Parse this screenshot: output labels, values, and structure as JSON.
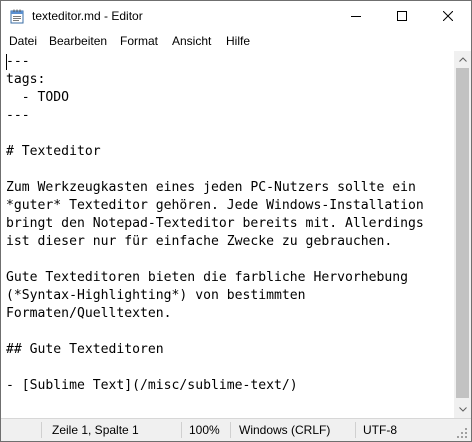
{
  "window": {
    "title": "texteditor.md - Editor"
  },
  "menu": {
    "items": [
      "Datei",
      "Bearbeiten",
      "Format",
      "Ansicht",
      "Hilfe"
    ]
  },
  "editor": {
    "content": "---\ntags:\n  - TODO\n---\n\n# Texteditor\n\nZum Werkzeugkasten eines jeden PC-Nutzers sollte ein\n*guter* Texteditor gehören. Jede Windows-Installation\nbringt den Notepad-Texteditor bereits mit. Allerdings\nist dieser nur für einfache Zwecke zu gebrauchen.\n\nGute Texteditoren bieten die farbliche Hervorhebung\n(*Syntax-Highlighting*) von bestimmten\nFormaten/Quelltexten.\n\n## Gute Texteditoren\n\n- [Sublime Text](/misc/sublime-text/)"
  },
  "status": {
    "position": "Zeile 1, Spalte 1",
    "zoom": "100%",
    "line_endings": "Windows (CRLF)",
    "encoding": "UTF-8"
  },
  "icons": {
    "app": "notepad-icon",
    "minimize": "minimize-icon",
    "maximize": "maximize-icon",
    "close": "close-icon"
  }
}
